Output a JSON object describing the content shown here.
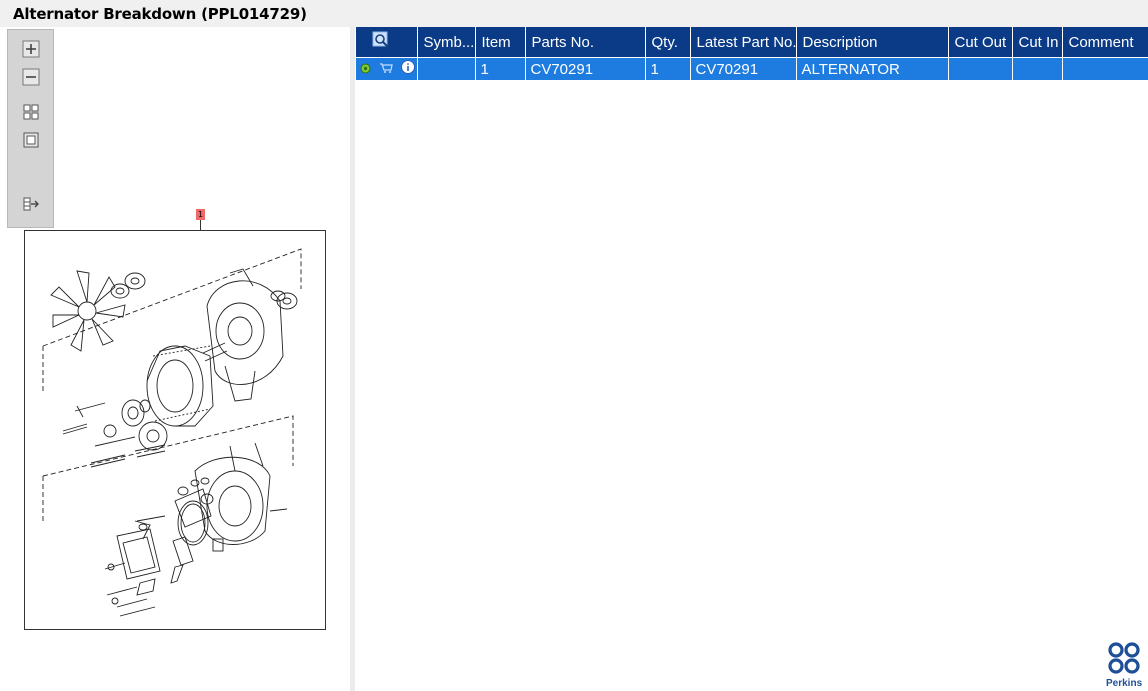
{
  "window": {
    "title": "Alternator Breakdown (PPL014729)"
  },
  "toolbar": {
    "buttons": [
      "zoom-in",
      "zoom-out",
      "fit-all",
      "fit-window",
      "export"
    ]
  },
  "diagram": {
    "callout_label": "1"
  },
  "table": {
    "columns": [
      "",
      "Symb...",
      "Item",
      "Parts No.",
      "Qty.",
      "Latest Part No.",
      "Description",
      "Cut Out",
      "Cut In",
      "Comment"
    ],
    "rows": [
      {
        "symb": "",
        "item": "1",
        "parts_no": "CV70291",
        "qty": "1",
        "latest_part_no": "CV70291",
        "description": "ALTERNATOR",
        "cut_out": "",
        "cut_in": "",
        "comment": ""
      }
    ]
  },
  "brand": {
    "name": "Perkins",
    "color": "#1d4f99"
  },
  "colors": {
    "header": "#0b3b86",
    "selected_row": "#1e7ce0",
    "callout": "#ee6a6a"
  }
}
